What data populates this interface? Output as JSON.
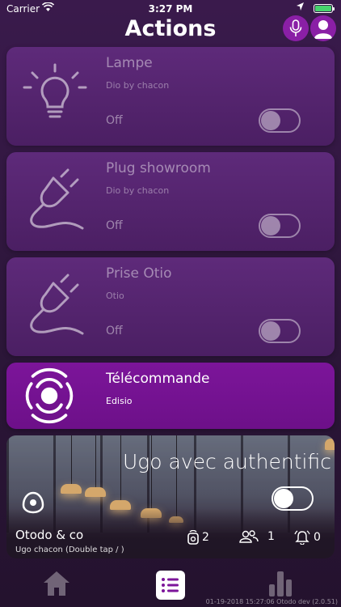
{
  "status_bar": {
    "carrier": "Carrier",
    "time": "3:27 PM"
  },
  "header": {
    "title": "Actions"
  },
  "devices": [
    {
      "name": "Lampe",
      "brand": "Dio by chacon",
      "state": "Off",
      "icon": "lightbulb-icon"
    },
    {
      "name": "Plug showroom",
      "brand": "Dio by chacon",
      "state": "Off",
      "icon": "plug-icon"
    },
    {
      "name": "Prise Otio",
      "brand": "Otio",
      "state": "Off",
      "icon": "plug-icon"
    },
    {
      "name": "Télécommande",
      "brand": "Edisio",
      "icon": "remote-icon"
    }
  ],
  "scene": {
    "title": "Ugo avec authentific",
    "home_name": "Otodo & co",
    "user_line": "Ugo chacon (Double tap / )",
    "stats": {
      "devices": "2",
      "users": "1",
      "alerts": "0"
    },
    "toggle_on": true
  },
  "tabbar": {
    "tabs": [
      "home-icon",
      "list-icon",
      "chart-icon"
    ],
    "active": "list-icon"
  },
  "footer_note": "01-19-2018 15:27:06 Otodo dev (2.0.51)",
  "colors": {
    "accent": "#8a1fa6",
    "active_card": "#7c159a",
    "card": "#5a2876",
    "background": "#2a1535"
  }
}
